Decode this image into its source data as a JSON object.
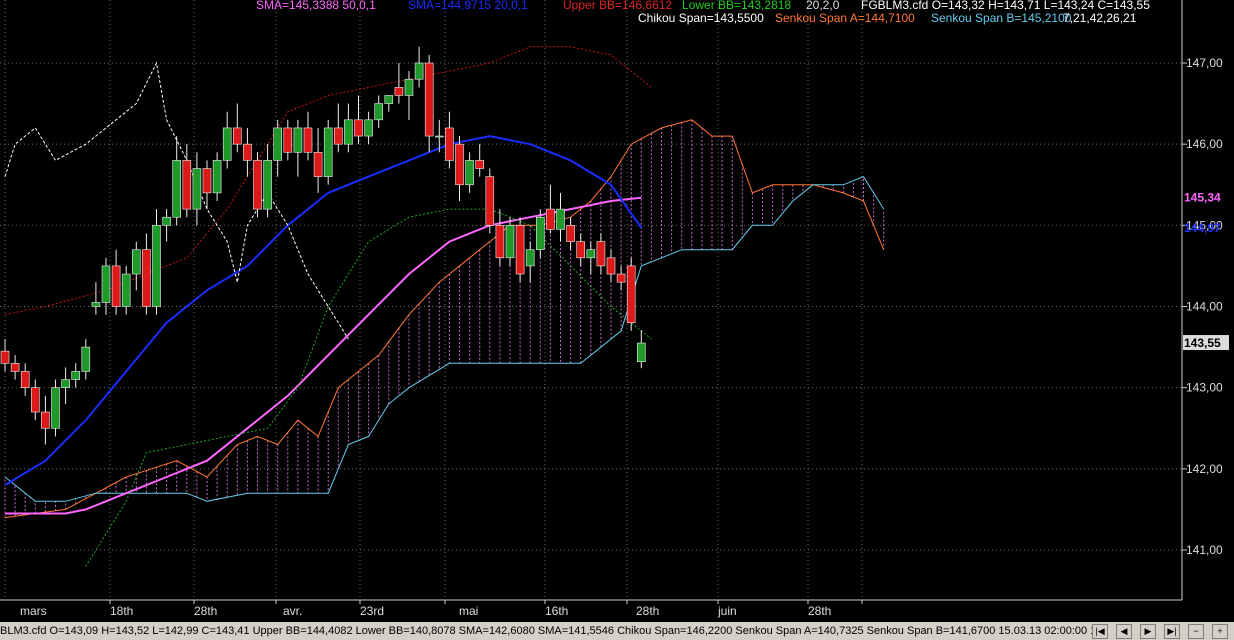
{
  "header": {
    "sma1": "SMA=145,3388  50,0,1",
    "sma2": "SMA=144,9715  20,0,1",
    "upper_bb": "Upper BB=146,6612",
    "lower_bb": "Lower BB=143,2818",
    "bb_params": "20,2,0",
    "ohlc": "FGBLM3.cfd O=143,32 H=143,71 L=143,24 C=143,55",
    "chikou": "Chikou Span=143,5500",
    "senkou_a": "Senkou Span A=144,7100",
    "senkou_b": "Senkou Span B=145,2100",
    "ichimoku_params": "7,21,42,26,21"
  },
  "price_axis": {
    "labels": [
      "147,00",
      "146,00",
      "145,00",
      "144,00",
      "143,00",
      "142,00",
      "141,00"
    ],
    "values": [
      147,
      146,
      145,
      144,
      143,
      142,
      141
    ],
    "sma_marker": "145,34",
    "sma_marker_value": 145.34,
    "last_marker": "144,97",
    "last_marker_value": 144.97,
    "close_marker": "143,55",
    "close_marker_value": 143.55
  },
  "time_axis": {
    "labels": [
      "mars",
      "18th",
      "28th",
      "avr.",
      "23rd",
      "mai",
      "16th",
      "28th",
      "juin",
      "28th"
    ]
  },
  "status": {
    "text": "BLM3.cfd O=143,09 H=143,52 L=142,99 C=143,41  Upper BB=144,4082 Lower BB=140,8078 SMA=142,6080 SMA=141,5546 Chikou Span=146,2200 Senkou Span A=140,7325 Senkou Span B=141,6700  15.03.13 02:00:00  1"
  },
  "colors": {
    "sma50": "#ff66ff",
    "sma20": "#1a2dff",
    "upper_bb": "#cc1111",
    "lower_bb": "#22aa22",
    "chikou": "#ffffff",
    "senkou_a": "#ff7733",
    "senkou_b": "#66ccee",
    "up": "#1f9a2a",
    "down": "#dd1a1a",
    "cloud": "#cc66cc"
  },
  "chart_data": {
    "type": "candlestick",
    "instrument": "FGBLM3.cfd",
    "ylim": [
      140.5,
      147.7
    ],
    "candles": [
      [
        143.45,
        143.6,
        143.2,
        143.3
      ],
      [
        143.3,
        143.4,
        143.1,
        143.2
      ],
      [
        143.2,
        143.3,
        142.9,
        143.0
      ],
      [
        143.0,
        143.1,
        142.6,
        142.7
      ],
      [
        142.7,
        142.9,
        142.3,
        142.5
      ],
      [
        142.5,
        143.1,
        142.4,
        143.0
      ],
      [
        143.0,
        143.25,
        142.8,
        143.1
      ],
      [
        143.1,
        143.3,
        143.0,
        143.2
      ],
      [
        143.2,
        143.6,
        143.1,
        143.5
      ],
      [
        144.0,
        144.3,
        143.9,
        144.05
      ],
      [
        144.05,
        144.6,
        143.9,
        144.5
      ],
      [
        144.5,
        144.7,
        143.9,
        144.0
      ],
      [
        144.0,
        144.5,
        143.9,
        144.4
      ],
      [
        144.4,
        144.8,
        144.2,
        144.7
      ],
      [
        144.7,
        144.9,
        143.9,
        144.0
      ],
      [
        144.0,
        145.2,
        143.9,
        145.0
      ],
      [
        145.0,
        145.2,
        144.8,
        145.1
      ],
      [
        145.1,
        146.1,
        145.0,
        145.8
      ],
      [
        145.8,
        146.0,
        145.1,
        145.2
      ],
      [
        145.2,
        145.9,
        145.0,
        145.7
      ],
      [
        145.7,
        145.8,
        145.2,
        145.4
      ],
      [
        145.4,
        145.9,
        145.3,
        145.8
      ],
      [
        145.8,
        146.4,
        145.7,
        146.2
      ],
      [
        146.2,
        146.5,
        145.9,
        146.0
      ],
      [
        146.0,
        146.2,
        145.6,
        145.8
      ],
      [
        145.8,
        145.9,
        145.1,
        145.2
      ],
      [
        145.2,
        146.0,
        145.1,
        145.8
      ],
      [
        145.8,
        146.3,
        145.6,
        146.2
      ],
      [
        146.2,
        146.3,
        145.8,
        145.9
      ],
      [
        145.9,
        146.3,
        145.6,
        146.2
      ],
      [
        146.2,
        146.4,
        145.8,
        145.9
      ],
      [
        145.9,
        146.2,
        145.4,
        145.6
      ],
      [
        145.6,
        146.3,
        145.5,
        146.2
      ],
      [
        146.2,
        146.5,
        145.9,
        146.0
      ],
      [
        146.0,
        146.5,
        145.9,
        146.3
      ],
      [
        146.3,
        146.6,
        146.0,
        146.1
      ],
      [
        146.1,
        146.4,
        146.0,
        146.3
      ],
      [
        146.3,
        146.6,
        146.2,
        146.5
      ],
      [
        146.5,
        146.6,
        146.4,
        146.6
      ],
      [
        146.7,
        147.0,
        146.5,
        146.6
      ],
      [
        146.6,
        146.9,
        146.3,
        146.8
      ],
      [
        146.8,
        147.2,
        146.7,
        147.0
      ],
      [
        147.0,
        147.1,
        145.9,
        146.1
      ],
      [
        146.1,
        146.3,
        145.9,
        146.1
      ],
      [
        146.2,
        146.4,
        145.7,
        145.8
      ],
      [
        146.0,
        146.1,
        145.3,
        145.5
      ],
      [
        145.5,
        145.9,
        145.4,
        145.8
      ],
      [
        145.8,
        146.0,
        145.6,
        145.7
      ],
      [
        145.6,
        145.7,
        144.9,
        145.0
      ],
      [
        145.0,
        145.2,
        144.5,
        144.6
      ],
      [
        144.6,
        145.1,
        144.5,
        145.0
      ],
      [
        145.0,
        145.1,
        144.3,
        144.4
      ],
      [
        144.5,
        144.8,
        144.3,
        144.7
      ],
      [
        144.7,
        145.2,
        144.6,
        145.1
      ],
      [
        145.2,
        145.5,
        144.9,
        144.95
      ],
      [
        144.95,
        145.4,
        144.8,
        145.2
      ],
      [
        145.0,
        145.1,
        144.7,
        144.8
      ],
      [
        144.8,
        144.9,
        144.5,
        144.6
      ],
      [
        144.6,
        144.8,
        144.4,
        144.7
      ],
      [
        144.8,
        144.9,
        144.4,
        144.5
      ],
      [
        144.6,
        144.7,
        144.3,
        144.4
      ],
      [
        144.4,
        144.5,
        144.2,
        144.3
      ],
      [
        144.5,
        144.6,
        143.7,
        143.8
      ],
      [
        143.32,
        143.71,
        143.24,
        143.55
      ]
    ]
  }
}
